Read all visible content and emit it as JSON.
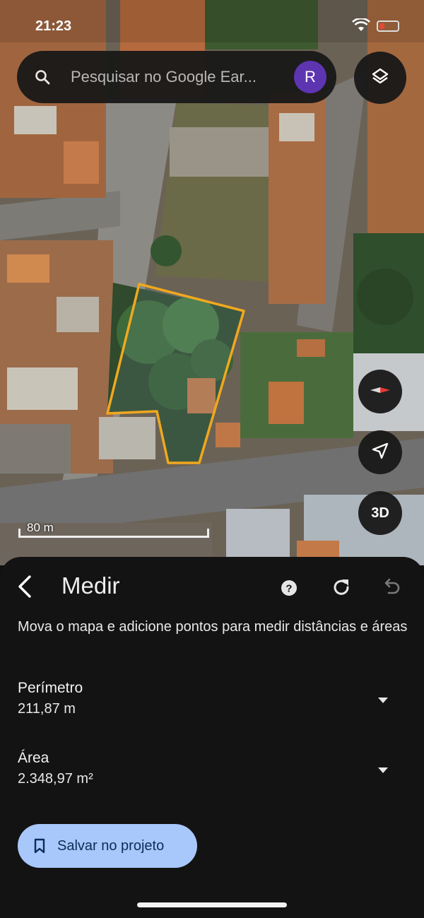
{
  "status": {
    "time": "21:23"
  },
  "search": {
    "placeholder": "Pesquisar no Google Ear...",
    "avatar_letter": "R"
  },
  "map": {
    "scale_label": "80 m",
    "threed_label": "3D"
  },
  "panel": {
    "title": "Medir",
    "description": "Mova o mapa e adicione pontos para medir distâncias e áreas",
    "perimeter": {
      "label": "Perímetro",
      "value": "211,87 m"
    },
    "area": {
      "label": "Área",
      "value": "2.348,97 m²"
    },
    "save_label": "Salvar no projeto"
  },
  "icons": [
    "search-icon",
    "layers-icon",
    "compass-icon",
    "locate-icon",
    "back-icon",
    "help-icon",
    "refresh-icon",
    "undo-icon",
    "chevron-down-icon",
    "bookmark-icon"
  ],
  "colors": {
    "measure_outline": "#f0a81e",
    "save_button": "#a8c8fb",
    "avatar": "#5e35b1",
    "sheet": "#131313"
  }
}
